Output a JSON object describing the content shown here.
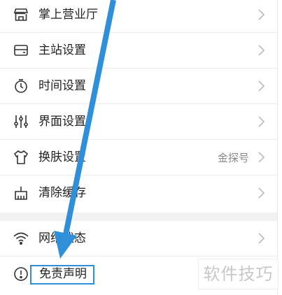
{
  "menu": {
    "items": [
      {
        "label": "掌上营业厅",
        "icon": "store-icon"
      },
      {
        "label": "主站设置",
        "icon": "card-icon"
      },
      {
        "label": "时间设置",
        "icon": "clock-icon"
      },
      {
        "label": "界面设置",
        "icon": "sliders-icon"
      },
      {
        "label": "换肤设置",
        "icon": "shirt-icon",
        "value": "金探号"
      },
      {
        "label": "清除缓存",
        "icon": "broom-icon"
      },
      {
        "label": "网络状态",
        "icon": "wifi-icon"
      },
      {
        "label": "免责声明",
        "icon": "alert-circle-icon"
      }
    ]
  },
  "watermark": "软件技巧",
  "colors": {
    "accent": "#2f8fd8",
    "label": "#222222",
    "value": "#888888",
    "divider": "#ececec",
    "chevron": "#b5b5b5"
  }
}
